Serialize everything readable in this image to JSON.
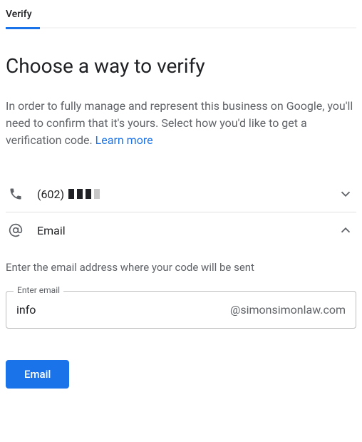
{
  "tab": {
    "label": "Verify"
  },
  "heading": "Choose a way to verify",
  "intro": {
    "text": "In order to fully manage and represent this business on Google, you'll need to confirm that it's yours. Select how you'd like to get a verification code. ",
    "learn_more": "Learn more"
  },
  "options": {
    "phone": {
      "label": "(602)"
    },
    "email": {
      "label": "Email"
    }
  },
  "email_section": {
    "instruction": "Enter the email address where your code will be sent",
    "legend": "Enter email",
    "value": "info",
    "domain": "@simonsimonlaw.com"
  },
  "actions": {
    "submit": "Email"
  }
}
